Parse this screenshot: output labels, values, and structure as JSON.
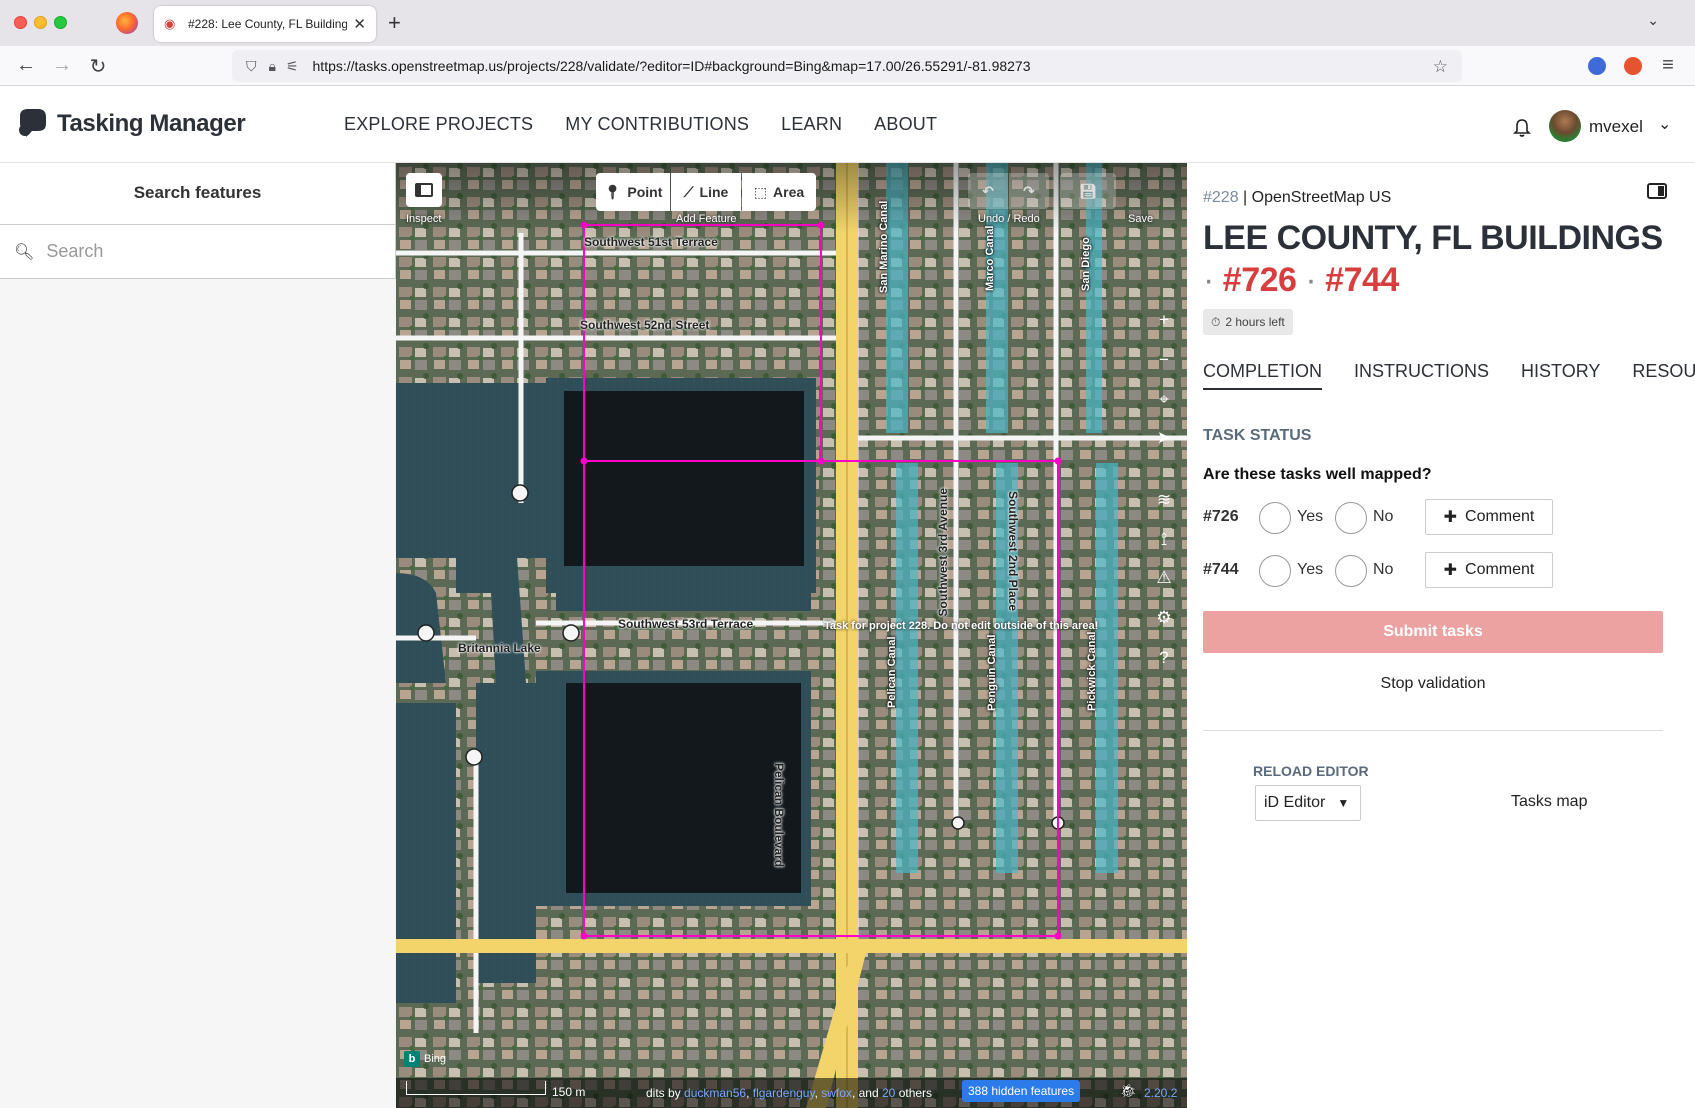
{
  "browser": {
    "tab_title": "#228: Lee County, FL Buildings",
    "tab_close": "✕",
    "new_tab": "+",
    "tab_list": "⌄",
    "url": "https://tasks.openstreetmap.us/projects/228/validate/?editor=ID#background=Bing&map=17.00/26.55291/-81.98273",
    "back": "←",
    "forward": "→",
    "reload": "↻",
    "menu": "≡"
  },
  "header": {
    "brand": "Tasking Manager",
    "nav": [
      "EXPLORE PROJECTS",
      "MY CONTRIBUTIONS",
      "LEARN",
      "ABOUT"
    ],
    "username": "mvexel"
  },
  "sidebar": {
    "title": "Search features",
    "search_placeholder": "Search"
  },
  "map": {
    "toolbar": {
      "inspect": "Inspect",
      "point": "Point",
      "line": "Line",
      "area": "Area",
      "add_feature": "Add Feature",
      "undo_redo": "Undo / Redo",
      "save": "Save"
    },
    "streets": {
      "sw51": "Southwest 51st Terrace",
      "sw52": "Southwest 52nd Street",
      "sw53": "Southwest 53rd Terrace",
      "pelican_blvd": "Pelican Boulevard",
      "sw3ave": "Southwest 3rd Avenue",
      "sw2pl": "Southwest 2nd Place",
      "san_marino": "San Marino Canal",
      "marco": "Marco Canal",
      "san_diego": "San Diego",
      "pelican_canal": "Pelican Canal",
      "penguin": "Penguin Canal",
      "pickwick": "Pickwick Canal",
      "lake": "Britannia Lake"
    },
    "task_note": "Task for project 228. Do not edit outside of this area!",
    "bing": "Bing",
    "scale": "150 m",
    "edits_prefix": "dits by",
    "editors": [
      "duckman56",
      "flgardenguy",
      "swfox"
    ],
    "edits_and": "and",
    "edits_count": "20",
    "edits_others": "others",
    "hidden_features": "388 hidden features",
    "version": "2.20.2"
  },
  "panel": {
    "project_id": "#228",
    "org": "OpenStreetMap US",
    "title": "LEE COUNTY, FL BUILDINGS",
    "task_a": "#726",
    "task_b": "#744",
    "sep": "·",
    "time_left": "2 hours left",
    "tabs": [
      "COMPLETION",
      "INSTRUCTIONS",
      "HISTORY",
      "RESOURCES"
    ],
    "status_label": "TASK STATUS",
    "question": "Are these tasks well mapped?",
    "yes": "Yes",
    "no": "No",
    "comment": "Comment",
    "submit": "Submit tasks",
    "stop": "Stop validation",
    "reload_label": "RELOAD EDITOR",
    "editor_value": "iD Editor",
    "tasks_map": "Tasks map"
  },
  "colors": {
    "accent_red": "#d73f3f",
    "submit_disabled": "#eda2a2",
    "task_boundary": "#ff00c8",
    "road_major": "#f2d46a",
    "hidden_badge": "#2b7bea"
  }
}
